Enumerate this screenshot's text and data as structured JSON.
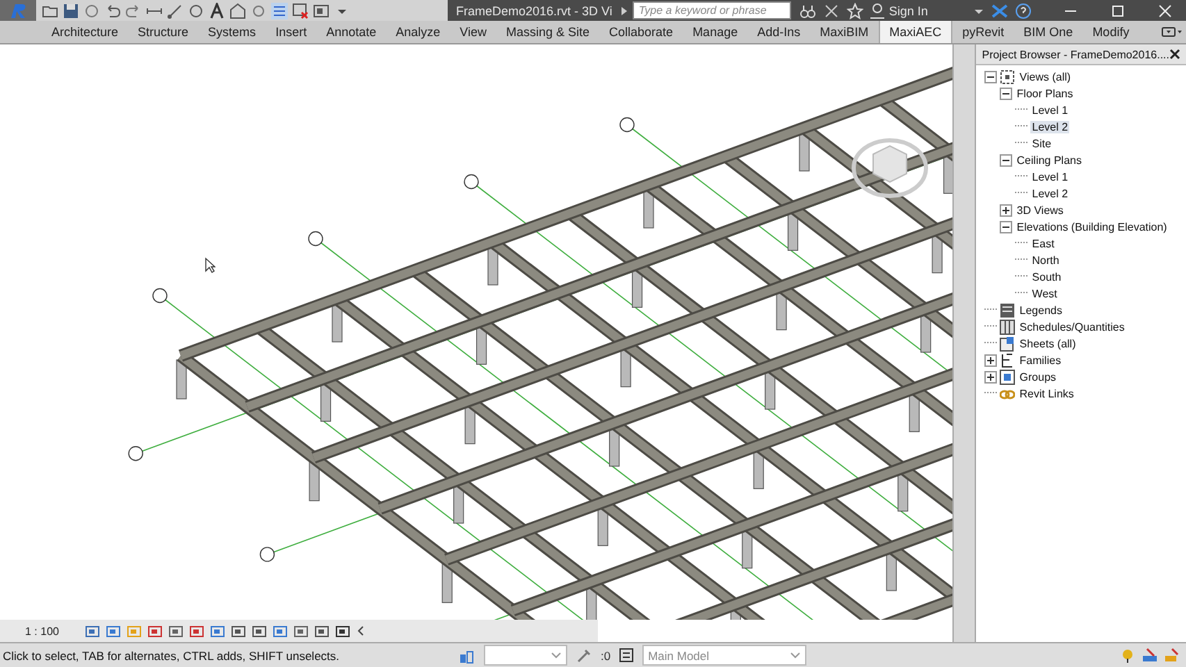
{
  "app": {
    "title": "FrameDemo2016.rvt - 3D Vi",
    "search": {
      "placeholder": "Type a keyword or phrase"
    },
    "sign_in": "Sign In"
  },
  "ribbon_tabs": [
    {
      "label": "Architecture",
      "selected": false
    },
    {
      "label": "Structure",
      "selected": false
    },
    {
      "label": "Systems",
      "selected": false
    },
    {
      "label": "Insert",
      "selected": false
    },
    {
      "label": "Annotate",
      "selected": false
    },
    {
      "label": "Analyze",
      "selected": false
    },
    {
      "label": "View",
      "selected": false
    },
    {
      "label": "Massing & Site",
      "selected": false
    },
    {
      "label": "Collaborate",
      "selected": false
    },
    {
      "label": "Manage",
      "selected": false
    },
    {
      "label": "Add-Ins",
      "selected": false
    },
    {
      "label": "MaxiBIM",
      "selected": false
    },
    {
      "label": "MaxiAEC",
      "selected": true
    },
    {
      "label": "pyRevit",
      "selected": false
    },
    {
      "label": "BIM One",
      "selected": false
    },
    {
      "label": "Modify",
      "selected": false
    }
  ],
  "project_browser": {
    "title": "Project Browser - FrameDemo2016....",
    "tree": [
      {
        "label": "Views (all)",
        "kind": "views",
        "expanded": true,
        "selected": false,
        "children": [
          {
            "label": "Floor Plans",
            "expanded": true,
            "selected": false,
            "children": [
              {
                "label": "Level 1",
                "selected": false
              },
              {
                "label": "Level 2",
                "selected": true
              },
              {
                "label": "Site",
                "selected": false
              }
            ]
          },
          {
            "label": "Ceiling Plans",
            "expanded": true,
            "selected": false,
            "children": [
              {
                "label": "Level 1",
                "selected": false
              },
              {
                "label": "Level 2",
                "selected": false
              }
            ]
          },
          {
            "label": "3D Views",
            "expanded": false,
            "selected": false
          },
          {
            "label": "Elevations (Building Elevation)",
            "expanded": true,
            "selected": false,
            "children": [
              {
                "label": "East",
                "selected": false
              },
              {
                "label": "North",
                "selected": false
              },
              {
                "label": "South",
                "selected": false
              },
              {
                "label": "West",
                "selected": false
              }
            ]
          }
        ]
      },
      {
        "label": "Legends",
        "kind": "legends",
        "selected": false
      },
      {
        "label": "Schedules/Quantities",
        "kind": "schedules",
        "selected": false
      },
      {
        "label": "Sheets (all)",
        "kind": "sheets",
        "selected": false
      },
      {
        "label": "Families",
        "kind": "families",
        "expanded": false,
        "selected": false
      },
      {
        "label": "Groups",
        "kind": "groups",
        "expanded": false,
        "selected": false
      },
      {
        "label": "Revit Links",
        "kind": "links",
        "selected": false
      }
    ]
  },
  "view_control": {
    "scale": "1 : 100"
  },
  "status_bar": {
    "message": "Click to select, TAB for alternates, CTRL adds, SHIFT unselects.",
    "selection_count": ":0",
    "workset": "Main Model"
  }
}
